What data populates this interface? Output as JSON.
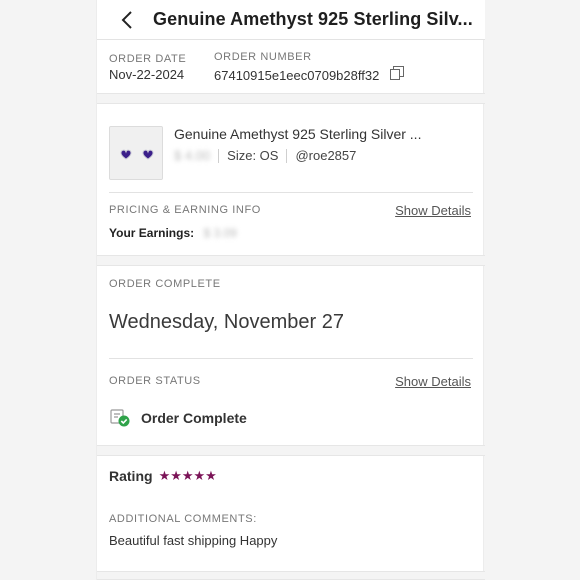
{
  "header": {
    "title": "Genuine Amethyst 925 Sterling Silv...",
    "back_icon": "chevron-left-icon"
  },
  "order": {
    "date_label": "ORDER DATE",
    "date_value": "Nov-22-2024",
    "number_label": "ORDER NUMBER",
    "number_value": "67410915e1eec0709b28ff32",
    "copy_icon": "copy-icon"
  },
  "item": {
    "title": "Genuine Amethyst 925 Sterling Silver ...",
    "price_blurred": "$ 4.00",
    "size": "Size: OS",
    "seller": "@roe2857",
    "thumbnail_icon": "heart-earrings-image"
  },
  "pricing": {
    "label": "PRICING & EARNING INFO",
    "link": "Show Details",
    "earnings_label": "Your Earnings:",
    "earnings_blurred": "$ 3.09"
  },
  "complete": {
    "label": "ORDER COMPLETE",
    "date": "Wednesday, November 27"
  },
  "status": {
    "label": "ORDER STATUS",
    "link": "Show Details",
    "text": "Order Complete",
    "icon": "order-complete-check-icon"
  },
  "rating": {
    "label": "Rating",
    "stars": 5,
    "star_color": "#7b1357",
    "stars_text": "★★★★★"
  },
  "comments": {
    "label": "ADDITIONAL COMMENTS:",
    "text": "Beautiful fast shipping Happy"
  },
  "colors": {
    "accent": "#7b1357",
    "check_green": "#2fa34a"
  }
}
